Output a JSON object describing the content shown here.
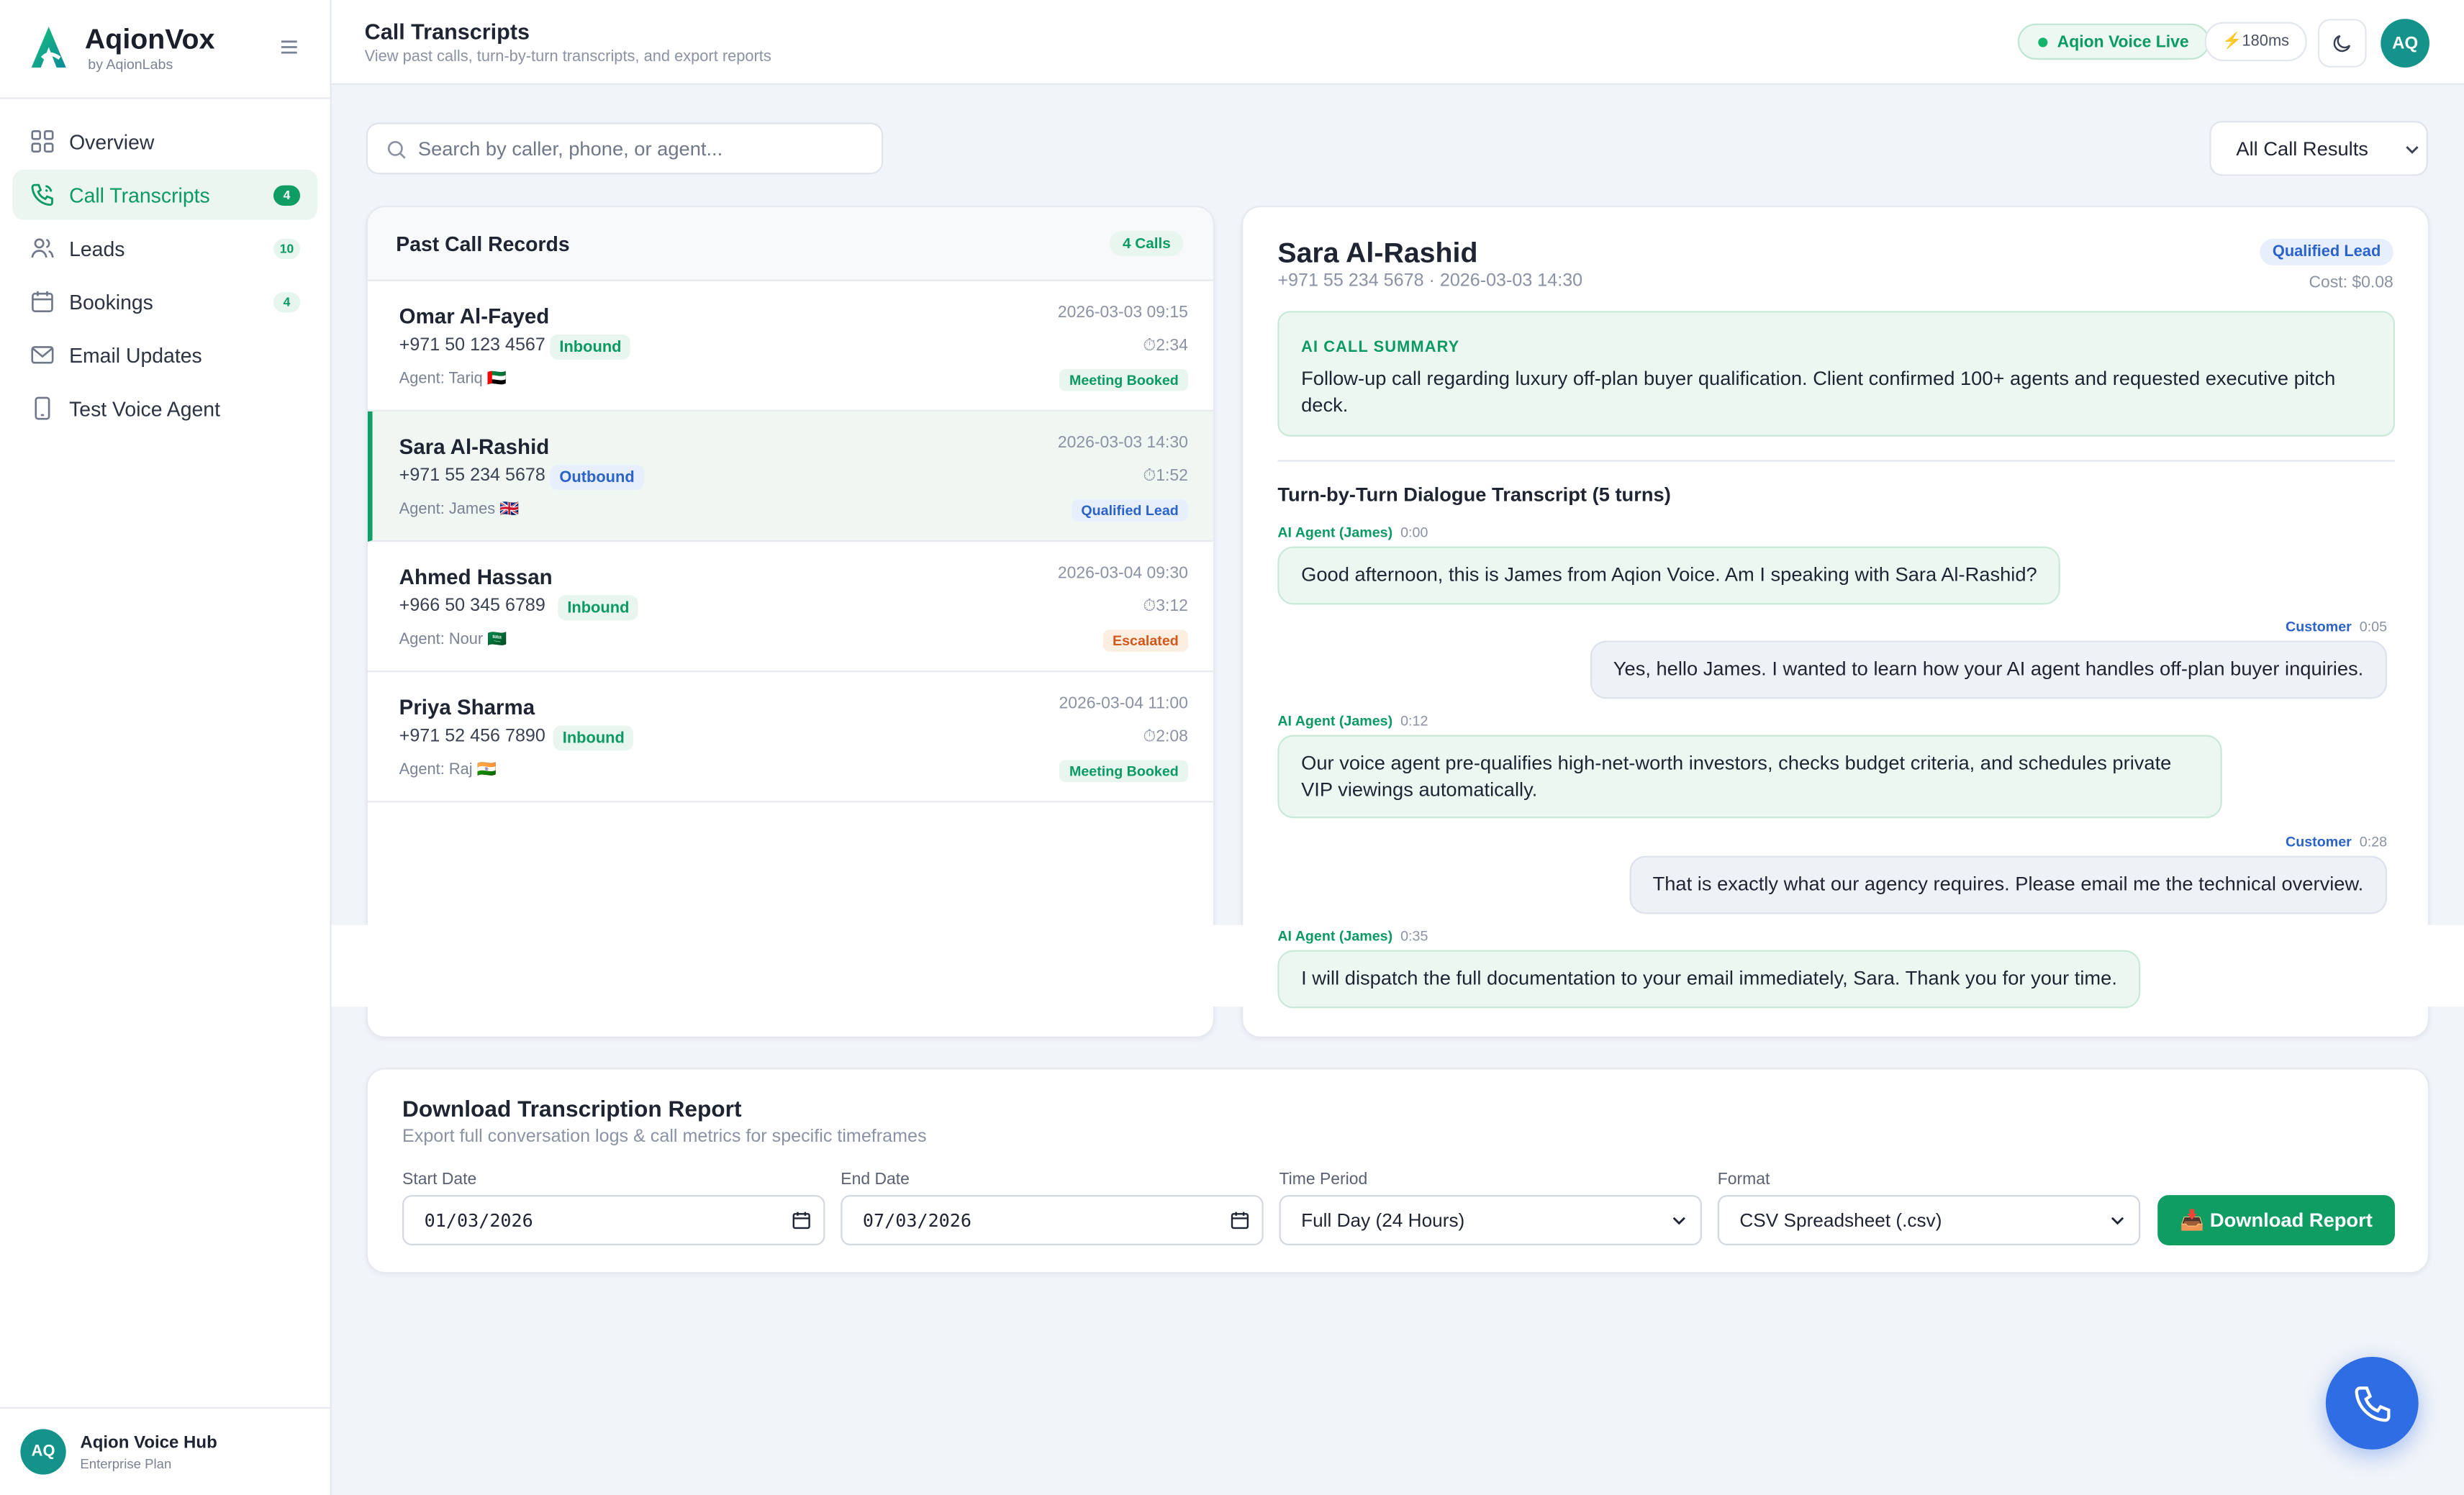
{
  "brand": {
    "name": "AqionVox",
    "sub": "by AqionLabs"
  },
  "sidebar": {
    "items": [
      {
        "label": "Overview",
        "icon": "grid-icon"
      },
      {
        "label": "Call Transcripts",
        "icon": "phone-icon",
        "badge": "4",
        "active": true
      },
      {
        "label": "Leads",
        "icon": "users-icon",
        "badge": "10"
      },
      {
        "label": "Bookings",
        "icon": "calendar-icon",
        "badge": "4"
      },
      {
        "label": "Email Updates",
        "icon": "mail-icon"
      },
      {
        "label": "Test Voice Agent",
        "icon": "mobile-icon"
      }
    ],
    "footer": {
      "initials": "AQ",
      "name": "Aqion Voice Hub",
      "plan": "Enterprise Plan"
    }
  },
  "header": {
    "title": "Call Transcripts",
    "subtitle": "View past calls, turn-by-turn transcripts, and export reports",
    "live_status": "Aqion Voice Live",
    "latency": "⚡180ms",
    "user_initials": "AQ"
  },
  "search": {
    "placeholder": "Search by caller, phone, or agent..."
  },
  "filter": {
    "selected": "All Call Results"
  },
  "call_list": {
    "title": "Past Call Records",
    "count_label": "4 Calls",
    "records": [
      {
        "name": "Omar Al-Fayed",
        "phone": "+971 50 123 4567",
        "direction": "Inbound",
        "agent": "Agent: Tariq 🇦🇪",
        "datetime": "2026-03-03 09:15",
        "duration": "⏱2:34",
        "result": "Meeting Booked"
      },
      {
        "name": "Sara Al-Rashid",
        "phone": "+971 55 234 5678",
        "direction": "Outbound",
        "agent": "Agent: James 🇬🇧",
        "datetime": "2026-03-03 14:30",
        "duration": "⏱1:52",
        "result": "Qualified Lead"
      },
      {
        "name": "Ahmed Hassan",
        "phone": "+966 50 345 6789",
        "direction": "Inbound",
        "agent": "Agent: Nour 🇸🇦",
        "datetime": "2026-03-04 09:30",
        "duration": "⏱3:12",
        "result": "Escalated"
      },
      {
        "name": "Priya Sharma",
        "phone": "+971 52 456 7890",
        "direction": "Inbound",
        "agent": "Agent: Raj 🇮🇳",
        "datetime": "2026-03-04 11:00",
        "duration": "⏱2:08",
        "result": "Meeting Booked"
      }
    ]
  },
  "detail": {
    "name": "Sara Al-Rashid",
    "meta": "+971 55 234 5678 · 2026-03-03 14:30",
    "badge": "Qualified Lead",
    "cost": "Cost: $0.08",
    "summary_label": "AI CALL SUMMARY",
    "summary": "Follow-up call regarding luxury off-plan buyer qualification. Client confirmed 100+ agents and requested executive pitch deck.",
    "transcript_title": "Turn-by-Turn Dialogue Transcript (5 turns)",
    "turns": [
      {
        "speaker": "AI Agent (James)",
        "time": "0:00",
        "text": "Good afternoon, this is James from Aqion Voice. Am I speaking with Sara Al-Rashid?"
      },
      {
        "speaker": "Customer",
        "time": "0:05",
        "text": "Yes, hello James. I wanted to learn how your AI agent handles off-plan buyer inquiries."
      },
      {
        "speaker": "AI Agent (James)",
        "time": "0:12",
        "text": "Our voice agent pre-qualifies high-net-worth investors, checks budget criteria, and schedules private VIP viewings automatically."
      },
      {
        "speaker": "Customer",
        "time": "0:28",
        "text": "That is exactly what our agency requires. Please email me the technical overview."
      },
      {
        "speaker": "AI Agent (James)",
        "time": "0:35",
        "text": "I will dispatch the full documentation to your email immediately, Sara. Thank you for your time."
      }
    ]
  },
  "report": {
    "title": "Download Transcription Report",
    "subtitle": "Export full conversation logs & call metrics for specific timeframes",
    "start_label": "Start Date",
    "start_value": "01/03/2026",
    "end_label": "End Date",
    "end_value": "07/03/2026",
    "period_label": "Time Period",
    "period_value": "Full Day (24 Hours)",
    "format_label": "Format",
    "format_value": "CSV Spreadsheet (.csv)",
    "download_label": "📥 Download Report"
  },
  "colors": {
    "accent": "#0f9d63",
    "blue": "#2b63c8",
    "fab": "#2f6de4",
    "warning": "#d2581a"
  }
}
